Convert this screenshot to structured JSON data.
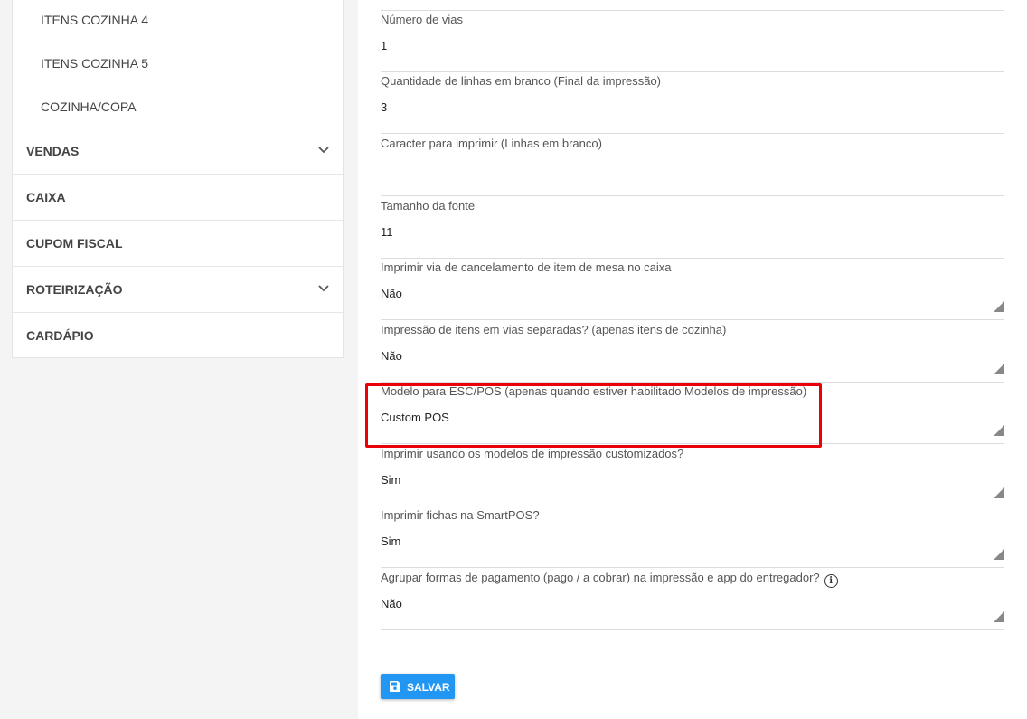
{
  "sidebar": {
    "sub_items": [
      "ITENS COZINHA 4",
      "ITENS COZINHA 5",
      "COZINHA/COPA"
    ],
    "menu": [
      {
        "label": "VENDAS",
        "expandable": true
      },
      {
        "label": "CAIXA",
        "expandable": false
      },
      {
        "label": "CUPOM FISCAL",
        "expandable": false
      },
      {
        "label": "ROTEIRIZAÇÃO",
        "expandable": true
      },
      {
        "label": "CARDÁPIO",
        "expandable": false
      }
    ]
  },
  "form": {
    "fields": [
      {
        "label": "Número de vias",
        "value": "1"
      },
      {
        "label": "Quantidade de linhas em branco (Final da impressão)",
        "value": "3"
      },
      {
        "label": "Caracter para imprimir (Linhas em branco)",
        "value": ""
      },
      {
        "label": "Tamanho da fonte",
        "value": "11"
      },
      {
        "label": "Imprimir via de cancelamento de item de mesa no caixa",
        "value": "Não"
      },
      {
        "label": "Impressão de itens em vias separadas? (apenas itens de cozinha)",
        "value": "Não"
      },
      {
        "label": "Modelo para ESC/POS (apenas quando estiver habilitado Modelos de impressão)",
        "value": "Custom POS"
      },
      {
        "label": "Imprimir usando os modelos de impressão customizados?",
        "value": "Sim"
      },
      {
        "label": "Imprimir fichas na SmartPOS?",
        "value": "Sim"
      },
      {
        "label": "Agrupar formas de pagamento (pago / a cobrar) na impressão e app do entregador?",
        "value": "Não"
      }
    ],
    "info_icon_glyph": "i",
    "save_label": "SALVAR"
  },
  "colors": {
    "accent": "#2196f3",
    "highlight": "#e8000b"
  }
}
